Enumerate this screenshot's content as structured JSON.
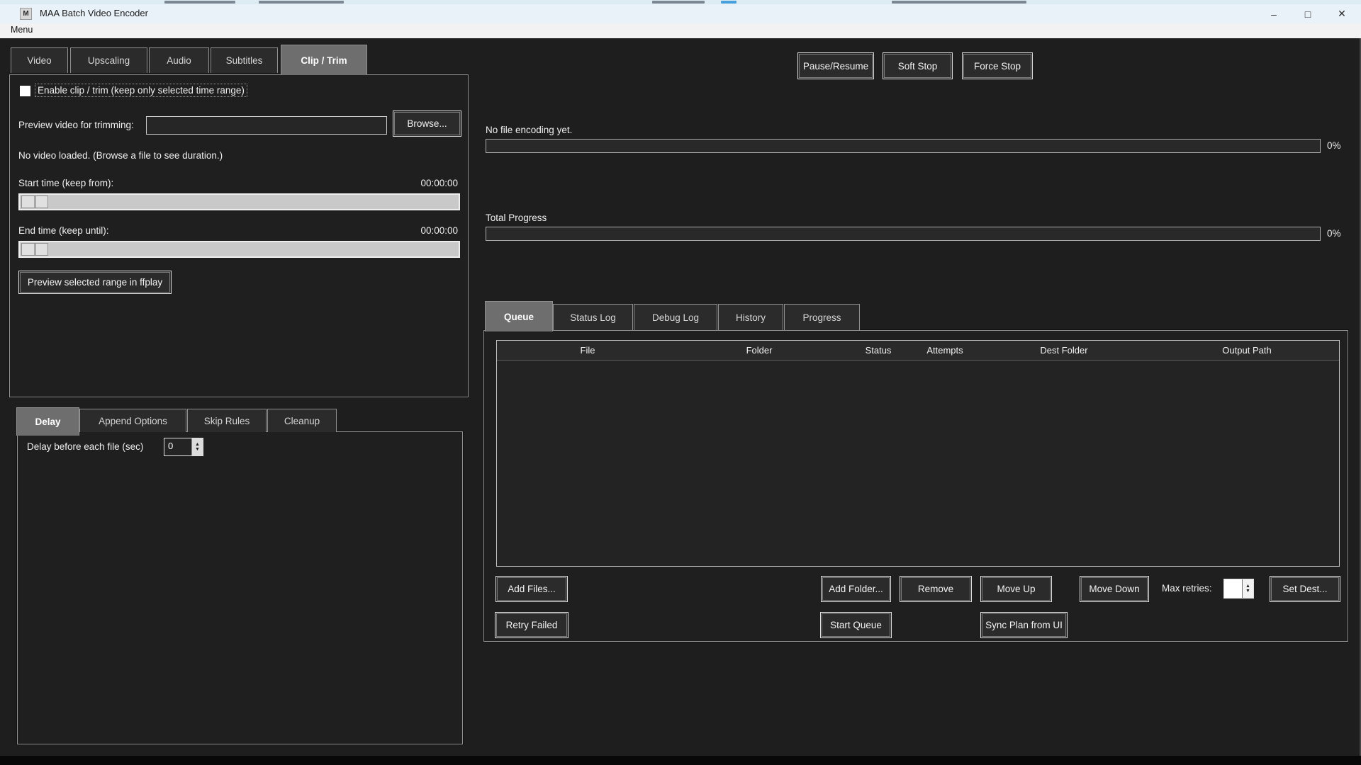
{
  "window": {
    "title": "MAA Batch Video Encoder",
    "menu_label": "Menu",
    "controls": {
      "minimize": "–",
      "maximize": "□",
      "close": "✕"
    }
  },
  "colors": {
    "titlebar": "#e9f2f8",
    "content_bg": "#1e1e1e",
    "active_tab": "#6e6e6e",
    "slider_trough": "#c9c9c9",
    "progress_trough": "#292929"
  },
  "left_tabs": {
    "items": [
      "Video",
      "Upscaling",
      "Audio",
      "Subtitles",
      "Clip / Trim"
    ],
    "active": "Clip / Trim"
  },
  "clip_trim": {
    "enable_label": "Enable clip / trim (keep only selected time range)",
    "preview_label": "Preview video for trimming:",
    "preview_value": "",
    "browse_button": "Browse...",
    "no_video_text": "No video loaded. (Browse a file to see duration.)",
    "start_label": "Start time (keep from):",
    "start_value": "00:00:00",
    "end_label": "End time (keep until):",
    "end_value": "00:00:00",
    "preview_range_button": "Preview selected range in ffplay"
  },
  "options_tabs": {
    "items": [
      "Delay",
      "Append Options",
      "Skip Rules",
      "Cleanup"
    ],
    "active": "Delay"
  },
  "delay_tab": {
    "label": "Delay before each file (sec)",
    "value": "0"
  },
  "encoder_controls": {
    "pause_resume": "Pause/Resume",
    "soft_stop": "Soft Stop",
    "force_stop": "Force Stop"
  },
  "progress": {
    "current_label": "No file encoding yet.",
    "current_percent": "0%",
    "total_label": "Total Progress",
    "total_percent": "0%"
  },
  "queue_tabs": {
    "items": [
      "Queue",
      "Status Log",
      "Debug Log",
      "History",
      "Progress"
    ],
    "active": "Queue"
  },
  "queue": {
    "columns": [
      "File",
      "Folder",
      "Status",
      "Attempts",
      "Dest Folder",
      "Output Path"
    ],
    "rows": [],
    "buttons": {
      "add_files": "Add Files...",
      "add_folder": "Add Folder...",
      "remove": "Remove",
      "move_up": "Move Up",
      "move_down": "Move Down",
      "max_retries_label": "Max retries:",
      "max_retries_value": "",
      "set_dest": "Set Dest...",
      "retry_failed": "Retry Failed",
      "start_queue": "Start Queue",
      "sync_plan": "Sync Plan from UI"
    }
  }
}
